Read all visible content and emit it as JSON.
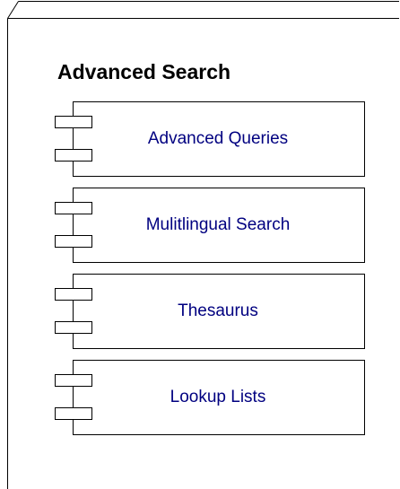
{
  "package": {
    "title": "Advanced Search"
  },
  "components": [
    {
      "label": "Advanced Queries"
    },
    {
      "label": "Mulitlingual Search"
    },
    {
      "label": "Thesaurus"
    },
    {
      "label": "Lookup Lists"
    }
  ],
  "colors": {
    "background": "#ffffff",
    "line": "#000000",
    "component_label": "#000080",
    "title": "#000000"
  },
  "icons": {
    "component": "uml-component-icon"
  }
}
